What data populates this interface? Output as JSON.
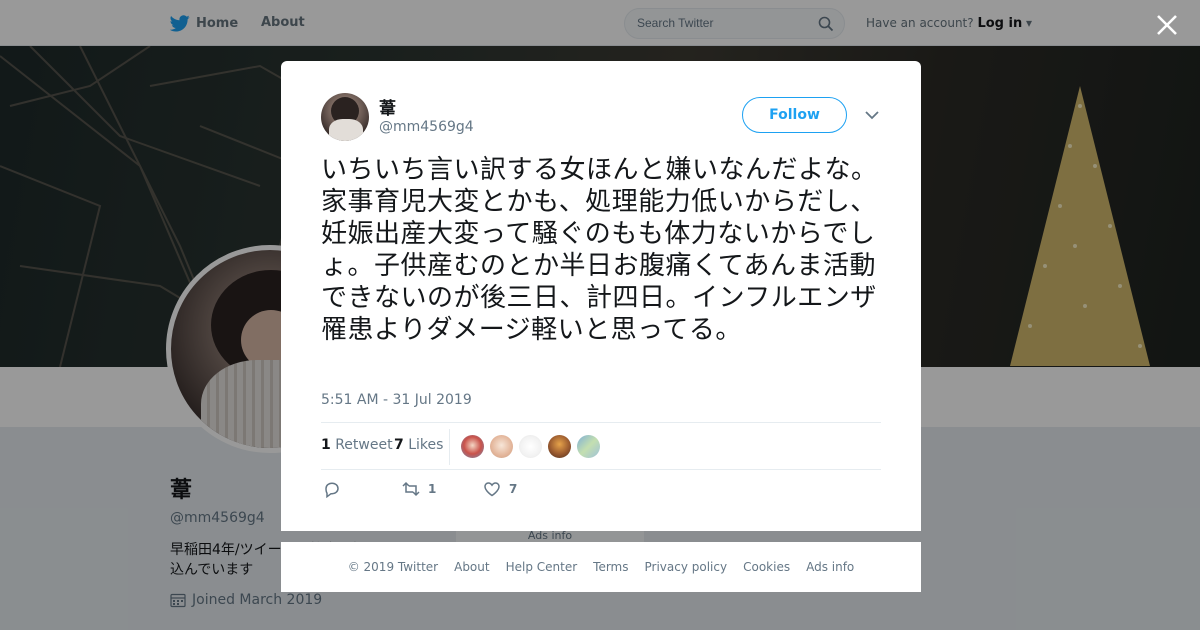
{
  "nav": {
    "home_label": "Home",
    "about_label": "About",
    "search_placeholder": "Search Twitter",
    "have_account": "Have an account?",
    "login_label": "Log in"
  },
  "profile": {
    "name": "葦",
    "handle": "@mm4569g4",
    "bio": "早稲田4年/ツイートは笹舟で打ち込んでいます",
    "joined": "Joined March 2019"
  },
  "background_ads": "Ads info",
  "tweet": {
    "name": "葦",
    "handle": "@mm4569g4",
    "follow_label": "Follow",
    "text": "いちいち言い訳する女ほんと嫌いなんだよな。家事育児大変とかも、処理能力低いからだし、妊娠出産大変って騒ぐのもも体力ないからでしょ。子供産むのとか半日お腹痛くてあんま活動できないのが後三日、計四日。インフルエンザ罹患よりダメージ軽いと思ってる。",
    "timestamp": "5:51 AM - 31 Jul 2019",
    "retweet_count": "1",
    "retweet_label": "Retweet",
    "like_count": "7",
    "like_label": "Likes",
    "action_retweet_count": "1",
    "action_like_count": "7"
  },
  "footer": {
    "copyright": "© 2019 Twitter",
    "about": "About",
    "help": "Help Center",
    "terms": "Terms",
    "privacy": "Privacy policy",
    "cookies": "Cookies",
    "ads": "Ads info"
  },
  "colors": {
    "accent": "#1da1f2",
    "muted": "#657786",
    "text": "#14171a"
  }
}
